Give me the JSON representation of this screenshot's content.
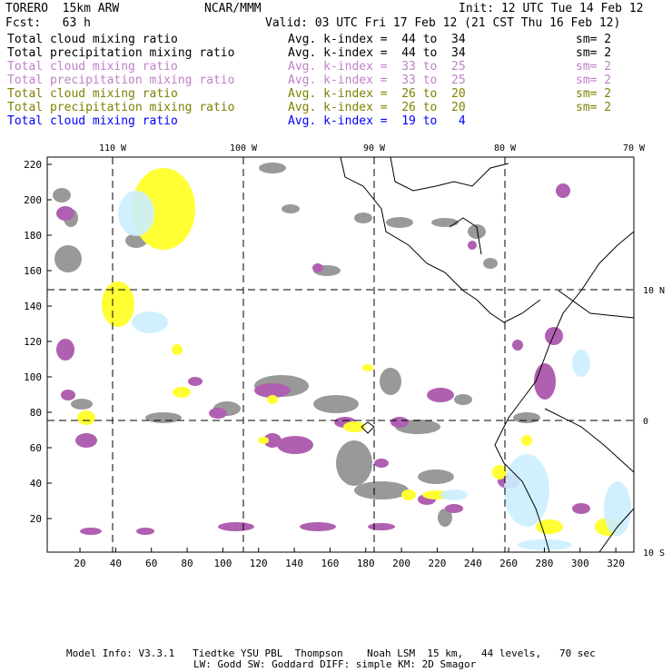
{
  "header": {
    "title": "TORERO  15km ARW",
    "org": "NCAR/MMM",
    "init": "Init: 12 UTC Tue 14 Feb 12",
    "fcst": "Fcst:   63 h",
    "valid": "Valid: 03 UTC Fri 17 Feb 12 (21 CST Thu 16 Feb 12)"
  },
  "fields": [
    {
      "name": "Total cloud mixing ratio",
      "range": "Avg. k-index =  44 to  34",
      "sm": "sm= 2",
      "color": "#000000"
    },
    {
      "name": "Total precipitation mixing ratio",
      "range": "Avg. k-index =  44 to  34",
      "sm": "sm= 2",
      "color": "#000000"
    },
    {
      "name": "Total cloud mixing ratio",
      "range": "Avg. k-index =  33 to  25",
      "sm": "sm= 2",
      "color": "#c080c8"
    },
    {
      "name": "Total precipitation mixing ratio",
      "range": "Avg. k-index =  33 to  25",
      "sm": "sm= 2",
      "color": "#c080c8"
    },
    {
      "name": "Total cloud mixing ratio",
      "range": "Avg. k-index =  26 to  20",
      "sm": "sm= 2",
      "color": "#808000"
    },
    {
      "name": "Total precipitation mixing ratio",
      "range": "Avg. k-index =  26 to  20",
      "sm": "sm= 2",
      "color": "#808000"
    },
    {
      "name": "Total cloud mixing ratio",
      "range": "Avg. k-index =  19 to   4",
      "sm": "",
      "color": "#0000ff"
    }
  ],
  "axes": {
    "x_ticks": [
      "20",
      "40",
      "60",
      "80",
      "100",
      "120",
      "140",
      "160",
      "180",
      "200",
      "220",
      "240",
      "260",
      "280",
      "300",
      "320"
    ],
    "y_ticks": [
      "20",
      "40",
      "60",
      "80",
      "100",
      "120",
      "140",
      "160",
      "180",
      "200",
      "220"
    ],
    "lon_labels": [
      "110 W",
      "100 W",
      "90 W",
      "80 W",
      "70 W"
    ],
    "lat_labels": [
      "10 N",
      "0",
      "10 S"
    ]
  },
  "footer": {
    "line1": "Model Info: V3.3.1   Tiedtke YSU PBL  Thompson    Noah LSM  15 km,   44 levels,   70 sec",
    "line2": "LW: Godd SW: Goddard DIFF: simple KM: 2D Smagor"
  },
  "colors": {
    "gray": "#999999",
    "purple": "#b060b0",
    "yellow": "#ffff33",
    "blue": "#cceeff"
  }
}
